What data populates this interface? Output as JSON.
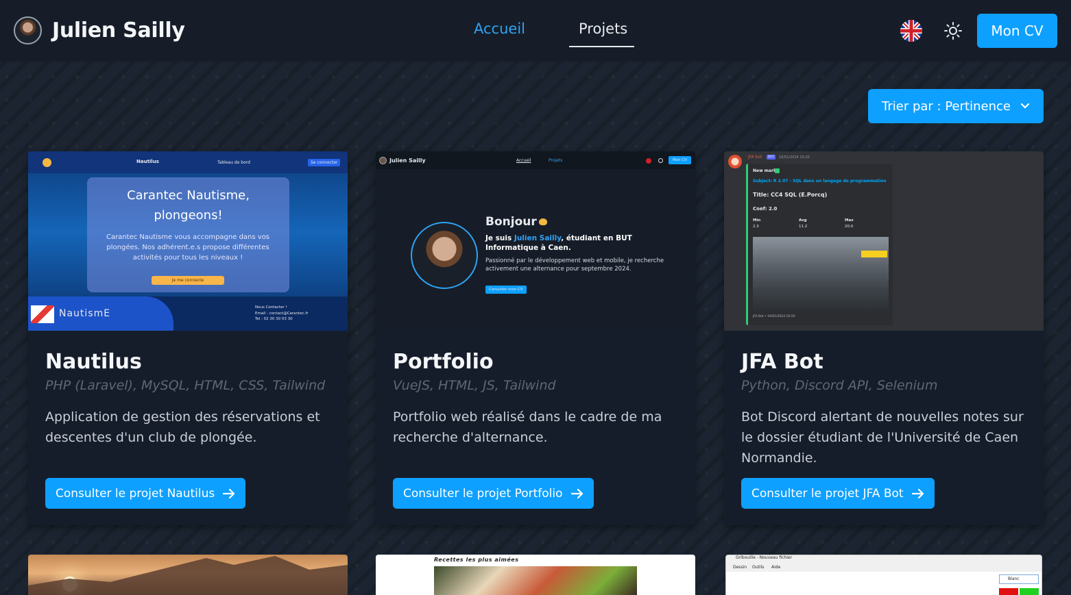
{
  "header": {
    "brand_name": "Julien Sailly",
    "nav": [
      {
        "label": "Accueil",
        "active": false
      },
      {
        "label": "Projets",
        "active": true
      }
    ],
    "language_icon": "uk-flag-icon",
    "theme_icon": "sun-icon",
    "cv_button": "Mon CV"
  },
  "sort": {
    "label": "Trier par : Pertinence",
    "icon": "chevron-down-icon"
  },
  "projects": [
    {
      "title": "Nautilus",
      "tech": "PHP (Laravel), MySQL, HTML, CSS, Tailwind",
      "description": "Application de gestion des réservations et descentes d'un club de plongée.",
      "button": "Consulter le projet Nautilus",
      "preview": {
        "nav_title": "Nautilus",
        "nav_link": "Tableau de bord",
        "nav_button": "Se connecter",
        "hero_title": "Carantec Nautisme, plongeons!",
        "hero_text": "Carantec Nautisme vous accompagne dans vos plongées. Nos adhérent.e.s propose différentes activités pour tous les niveaux !",
        "hero_button": "Je me connecte",
        "logo_text": "NautismE",
        "contact": "Nous Contacter !",
        "email": "Email : contact@Carantec.fr",
        "tel": "Tel : 02 30 30 03 30"
      }
    },
    {
      "title": "Portfolio",
      "tech": "VueJS, HTML, JS, Tailwind",
      "description": "Portfolio web réalisé dans le cadre de ma recherche d'alternance.",
      "button": "Consulter le projet Portfolio",
      "preview": {
        "brand": "Julien Sailly",
        "nav1": "Accueil",
        "nav2": "Projets",
        "cv": "Mon CV",
        "greeting": "Bonjour",
        "intro_prefix": "Je suis ",
        "intro_name": "Julien Sailly",
        "intro_suffix": ", étudiant en BUT Informatique à Caen.",
        "paragraph": "Passionné par le développement web et mobile, je recherche activement une alternance pour septembre 2024.",
        "cta": "Consulter mon CV"
      }
    },
    {
      "title": "JFA Bot",
      "tech": "Python, Discord API, Selenium",
      "description": "Bot Discord alertant de nouvelles notes sur le dossier étudiant de l'Université de Caen Normandie.",
      "button": "Consulter le projet JFA Bot",
      "preview": {
        "bot_name": "JFA bot",
        "bot_tag": "BOT",
        "timestamp": "16/01/2024 10:20",
        "new_mark": "New mark",
        "subject": "Subject: R 2.07 - SQL dans un langage de programmation",
        "title": "Title: CC4 SQL (E.Porcq)",
        "coef": "Coef: 2.0",
        "min_label": "Min",
        "min_value": "2.3",
        "avg_label": "Avg",
        "avg_value": "11.2",
        "max_label": "Max",
        "max_value": "20.0",
        "footer": "JFA Bot • 16/01/2024 10:20"
      }
    }
  ],
  "bottom_previews": {
    "recipes_title": "Recettes les plus aimées",
    "paint_title": "Gribouille - Nouveau fichier",
    "paint_menu": [
      "Dessin",
      "Outils",
      "Aide"
    ],
    "paint_select": "Blanc"
  }
}
